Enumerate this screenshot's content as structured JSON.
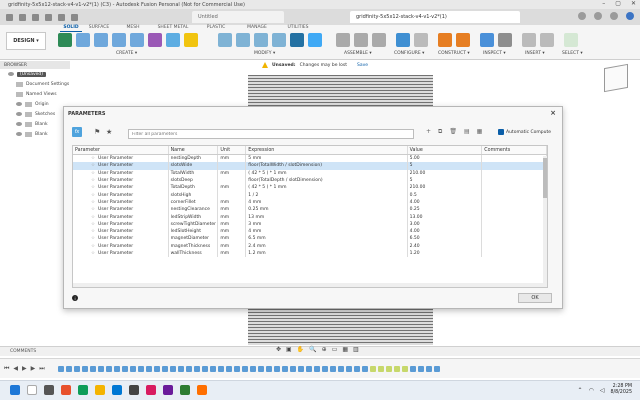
{
  "window": {
    "title": "gridfinity-5x5x12-stack-v4-v1-v2*(1) (C3) - Autodesk Fusion Personal (Not for Commercial Use)",
    "tabs": [
      {
        "label": "Untitled"
      },
      {
        "label": "gridfinity-5x5x12-stack-v4-v1-v2*(1)"
      }
    ]
  },
  "ribbon": {
    "workspace": "DESIGN ▾",
    "tabs": [
      "SOLID",
      "SURFACE",
      "MESH",
      "SHEET METAL",
      "PLASTIC",
      "MANAGE",
      "UTILITIES"
    ],
    "active_tab": "SOLID",
    "groups": [
      "CREATE ▾",
      "MODIFY ▾",
      "ASSEMBLE ▾",
      "CONFIGURE ▾",
      "CONSTRUCT ▾",
      "INSPECT ▾",
      "INSERT ▾",
      "SELECT ▾"
    ]
  },
  "browser": {
    "header": "BROWSER",
    "items": [
      "(Unsaved)",
      "Document Settings",
      "Named Views",
      "Origin",
      "Sketches",
      "Blank",
      "Blank"
    ]
  },
  "unsaved": {
    "label": "Unsaved:",
    "message": "Changes may be lost",
    "save": "Save"
  },
  "dialog": {
    "title": "PARAMETERS",
    "close": "×",
    "fx": "fx",
    "filter_placeholder": "Filter all parameters",
    "auto_compute": "Automatic Compute",
    "columns": [
      "Parameter",
      "Name",
      "Unit",
      "Expression",
      "Value",
      "Comments"
    ],
    "rows": [
      {
        "param": "User Parameter",
        "name": "nestingDepth",
        "unit": "mm",
        "expr": "5 mm",
        "value": "5.00"
      },
      {
        "param": "User Parameter",
        "name": "slotsWide",
        "unit": "",
        "expr": "floor(TotalWidth / slotDimension)",
        "value": "5",
        "selected": true
      },
      {
        "param": "User Parameter",
        "name": "TotalWidth",
        "unit": "mm",
        "expr": "( 42 * 5 ) * 1 mm",
        "value": "210.00"
      },
      {
        "param": "User Parameter",
        "name": "slotsDeep",
        "unit": "",
        "expr": "floor(TotalDepth / slotDimension)",
        "value": "5"
      },
      {
        "param": "User Parameter",
        "name": "TotalDepth",
        "unit": "mm",
        "expr": "( 42 * 5 ) * 1 mm",
        "value": "210.00"
      },
      {
        "param": "User Parameter",
        "name": "slotsHigh",
        "unit": "",
        "expr": "1 / 2",
        "value": "0.5"
      },
      {
        "param": "User Parameter",
        "name": "cornerFillet",
        "unit": "mm",
        "expr": "4 mm",
        "value": "4.00"
      },
      {
        "param": "User Parameter",
        "name": "nestingClearance",
        "unit": "mm",
        "expr": "0.25 mm",
        "value": "0.25"
      },
      {
        "param": "User Parameter",
        "name": "ledStripWidth",
        "unit": "mm",
        "expr": "13 mm",
        "value": "13.00"
      },
      {
        "param": "User Parameter",
        "name": "screwTightDiameter",
        "unit": "mm",
        "expr": "3 mm",
        "value": "3.00"
      },
      {
        "param": "User Parameter",
        "name": "ledSlotHeight",
        "unit": "mm",
        "expr": "4 mm",
        "value": "4.00"
      },
      {
        "param": "User Parameter",
        "name": "magnetDiameter",
        "unit": "mm",
        "expr": "6.5 mm",
        "value": "6.50"
      },
      {
        "param": "User Parameter",
        "name": "magnetThickness",
        "unit": "mm",
        "expr": "2.4 mm",
        "value": "2.40"
      },
      {
        "param": "User Parameter",
        "name": "wallThickness",
        "unit": "mm",
        "expr": "1.2 mm",
        "value": "1.20"
      }
    ],
    "ok": "OK"
  },
  "comments": {
    "label": "COMMENTS"
  },
  "taskbar": {
    "time": "2:28 PM",
    "date": "8/8/2025"
  }
}
